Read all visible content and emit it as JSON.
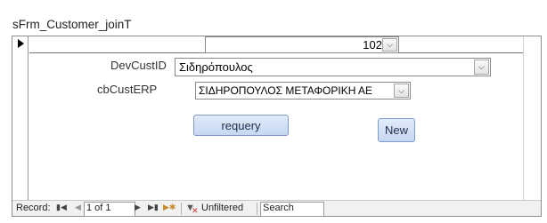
{
  "subform": {
    "name": "sFrm_Customer_joinT"
  },
  "record": {
    "top_combo_value": "102",
    "devcust": {
      "label": "DevCustID",
      "value": "Σιδηρόπουλος"
    },
    "custerp": {
      "label": "cbCustERP",
      "value": "ΣΙΔΗΡΟΠΟΥΛΟΣ ΜΕΤΑΦΟΡΙΚΗ ΑΕ"
    },
    "requery_label": "requery",
    "new_label": "New"
  },
  "navigation": {
    "record_label": "Record:",
    "position": "1 of 1",
    "filter_label": "Unfiltered",
    "search_placeholder": "Search"
  },
  "icons": {
    "first": "first-record-icon",
    "prev": "previous-record-icon",
    "next": "next-record-icon",
    "last": "last-record-icon",
    "new": "new-record-icon",
    "filter": "no-filter-icon",
    "dropdown": "chevron-down-icon",
    "selector": "record-selector-arrow-icon"
  }
}
